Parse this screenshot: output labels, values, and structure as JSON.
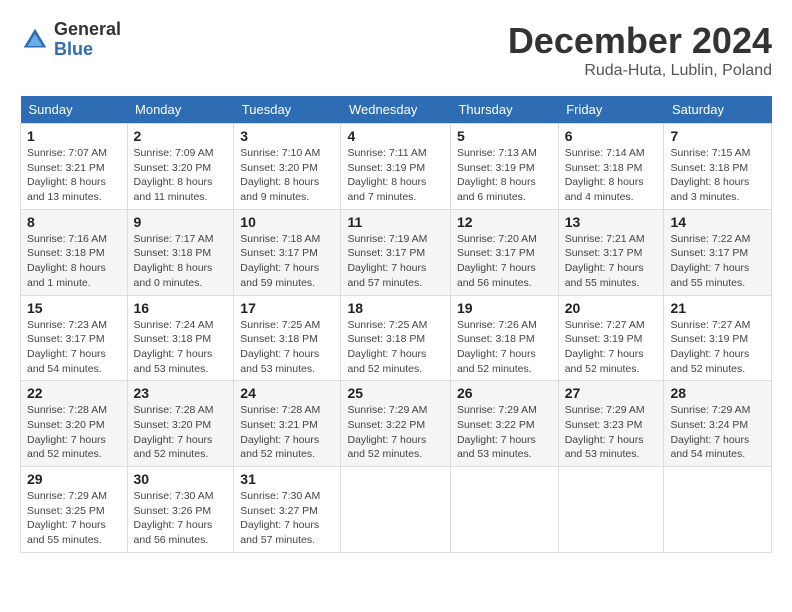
{
  "logo": {
    "general": "General",
    "blue": "Blue"
  },
  "title": {
    "month": "December 2024",
    "location": "Ruda-Huta, Lublin, Poland"
  },
  "days_of_week": [
    "Sunday",
    "Monday",
    "Tuesday",
    "Wednesday",
    "Thursday",
    "Friday",
    "Saturday"
  ],
  "weeks": [
    [
      {
        "day": "1",
        "sunrise": "7:07 AM",
        "sunset": "3:21 PM",
        "daylight": "8 hours and 13 minutes."
      },
      {
        "day": "2",
        "sunrise": "7:09 AM",
        "sunset": "3:20 PM",
        "daylight": "8 hours and 11 minutes."
      },
      {
        "day": "3",
        "sunrise": "7:10 AM",
        "sunset": "3:20 PM",
        "daylight": "8 hours and 9 minutes."
      },
      {
        "day": "4",
        "sunrise": "7:11 AM",
        "sunset": "3:19 PM",
        "daylight": "8 hours and 7 minutes."
      },
      {
        "day": "5",
        "sunrise": "7:13 AM",
        "sunset": "3:19 PM",
        "daylight": "8 hours and 6 minutes."
      },
      {
        "day": "6",
        "sunrise": "7:14 AM",
        "sunset": "3:18 PM",
        "daylight": "8 hours and 4 minutes."
      },
      {
        "day": "7",
        "sunrise": "7:15 AM",
        "sunset": "3:18 PM",
        "daylight": "8 hours and 3 minutes."
      }
    ],
    [
      {
        "day": "8",
        "sunrise": "7:16 AM",
        "sunset": "3:18 PM",
        "daylight": "8 hours and 1 minute."
      },
      {
        "day": "9",
        "sunrise": "7:17 AM",
        "sunset": "3:18 PM",
        "daylight": "8 hours and 0 minutes."
      },
      {
        "day": "10",
        "sunrise": "7:18 AM",
        "sunset": "3:17 PM",
        "daylight": "7 hours and 59 minutes."
      },
      {
        "day": "11",
        "sunrise": "7:19 AM",
        "sunset": "3:17 PM",
        "daylight": "7 hours and 57 minutes."
      },
      {
        "day": "12",
        "sunrise": "7:20 AM",
        "sunset": "3:17 PM",
        "daylight": "7 hours and 56 minutes."
      },
      {
        "day": "13",
        "sunrise": "7:21 AM",
        "sunset": "3:17 PM",
        "daylight": "7 hours and 55 minutes."
      },
      {
        "day": "14",
        "sunrise": "7:22 AM",
        "sunset": "3:17 PM",
        "daylight": "7 hours and 55 minutes."
      }
    ],
    [
      {
        "day": "15",
        "sunrise": "7:23 AM",
        "sunset": "3:17 PM",
        "daylight": "7 hours and 54 minutes."
      },
      {
        "day": "16",
        "sunrise": "7:24 AM",
        "sunset": "3:18 PM",
        "daylight": "7 hours and 53 minutes."
      },
      {
        "day": "17",
        "sunrise": "7:25 AM",
        "sunset": "3:18 PM",
        "daylight": "7 hours and 53 minutes."
      },
      {
        "day": "18",
        "sunrise": "7:25 AM",
        "sunset": "3:18 PM",
        "daylight": "7 hours and 52 minutes."
      },
      {
        "day": "19",
        "sunrise": "7:26 AM",
        "sunset": "3:18 PM",
        "daylight": "7 hours and 52 minutes."
      },
      {
        "day": "20",
        "sunrise": "7:27 AM",
        "sunset": "3:19 PM",
        "daylight": "7 hours and 52 minutes."
      },
      {
        "day": "21",
        "sunrise": "7:27 AM",
        "sunset": "3:19 PM",
        "daylight": "7 hours and 52 minutes."
      }
    ],
    [
      {
        "day": "22",
        "sunrise": "7:28 AM",
        "sunset": "3:20 PM",
        "daylight": "7 hours and 52 minutes."
      },
      {
        "day": "23",
        "sunrise": "7:28 AM",
        "sunset": "3:20 PM",
        "daylight": "7 hours and 52 minutes."
      },
      {
        "day": "24",
        "sunrise": "7:28 AM",
        "sunset": "3:21 PM",
        "daylight": "7 hours and 52 minutes."
      },
      {
        "day": "25",
        "sunrise": "7:29 AM",
        "sunset": "3:22 PM",
        "daylight": "7 hours and 52 minutes."
      },
      {
        "day": "26",
        "sunrise": "7:29 AM",
        "sunset": "3:22 PM",
        "daylight": "7 hours and 53 minutes."
      },
      {
        "day": "27",
        "sunrise": "7:29 AM",
        "sunset": "3:23 PM",
        "daylight": "7 hours and 53 minutes."
      },
      {
        "day": "28",
        "sunrise": "7:29 AM",
        "sunset": "3:24 PM",
        "daylight": "7 hours and 54 minutes."
      }
    ],
    [
      {
        "day": "29",
        "sunrise": "7:29 AM",
        "sunset": "3:25 PM",
        "daylight": "7 hours and 55 minutes."
      },
      {
        "day": "30",
        "sunrise": "7:30 AM",
        "sunset": "3:26 PM",
        "daylight": "7 hours and 56 minutes."
      },
      {
        "day": "31",
        "sunrise": "7:30 AM",
        "sunset": "3:27 PM",
        "daylight": "7 hours and 57 minutes."
      },
      null,
      null,
      null,
      null
    ]
  ]
}
